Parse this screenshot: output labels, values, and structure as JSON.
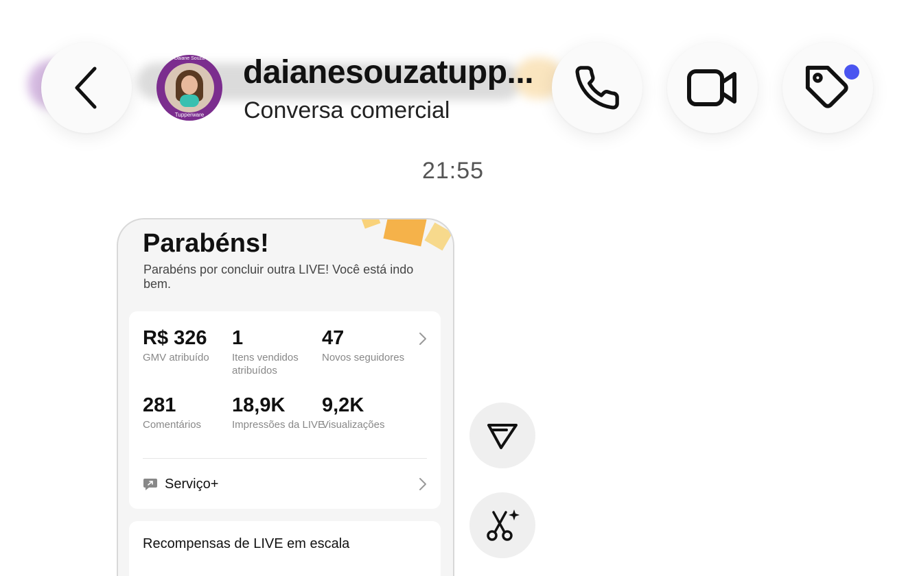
{
  "header": {
    "contact_name": "daianesouzatupp...",
    "subtitle": "Conversa comercial",
    "avatar": {
      "top_text": "Daiane Souza",
      "brand_text": "Tupperware"
    },
    "icons": {
      "back": "chevron-left-icon",
      "phone": "phone-icon",
      "video": "video-camera-icon",
      "tag": "tag-icon"
    },
    "notification_dot_color": "#4a55f0"
  },
  "thread": {
    "timestamp": "21:55"
  },
  "card": {
    "title": "Parabéns!",
    "description": "Parabéns por concluir outra LIVE! Você está indo bem.",
    "stats": [
      {
        "value": "R$ 326",
        "label": "GMV atribuído"
      },
      {
        "value": "1",
        "label": "Itens vendidos atribuídos"
      },
      {
        "value": "47",
        "label": "Novos seguidores"
      },
      {
        "value": "281",
        "label": "Comentários"
      },
      {
        "value": "18,9K",
        "label": "Impressões da LIVE"
      },
      {
        "value": "9,2K",
        "label": "Visualizações"
      }
    ],
    "service_label": "Serviço+",
    "rewards_title": "Recompensas de LIVE em escala"
  },
  "side_actions": {
    "forward_icon": "send-forward-icon",
    "ai_icon": "scissors-sparkle-icon"
  }
}
